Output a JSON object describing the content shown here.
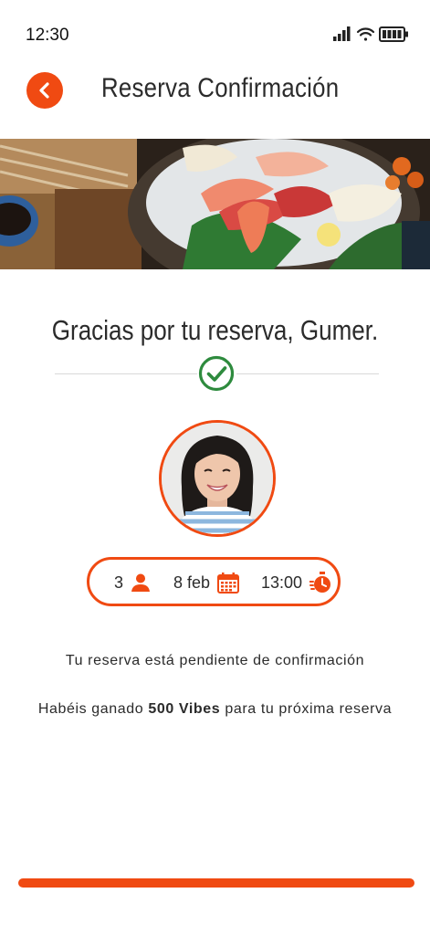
{
  "status_bar": {
    "time": "12:30"
  },
  "header": {
    "title": "Reserva Confirmación",
    "back_icon": "chevron-left-icon"
  },
  "confirmation": {
    "title": "Gracias por tu reserva, Gumer.",
    "check_icon": "check-circle-icon"
  },
  "booking": {
    "guests": "3",
    "date": "8 feb",
    "time": "13:00",
    "guests_icon": "person-icon",
    "date_icon": "calendar-icon",
    "time_icon": "stopwatch-icon"
  },
  "messages": {
    "pending": "Tu reserva está pendiente de confirmación",
    "vibes_prefix": "Habéis ganado ",
    "vibes_amount": "500 Vibes",
    "vibes_suffix": " para tu próxima reserva"
  },
  "colors": {
    "accent": "#f04a12",
    "success": "#2e8b3e"
  }
}
